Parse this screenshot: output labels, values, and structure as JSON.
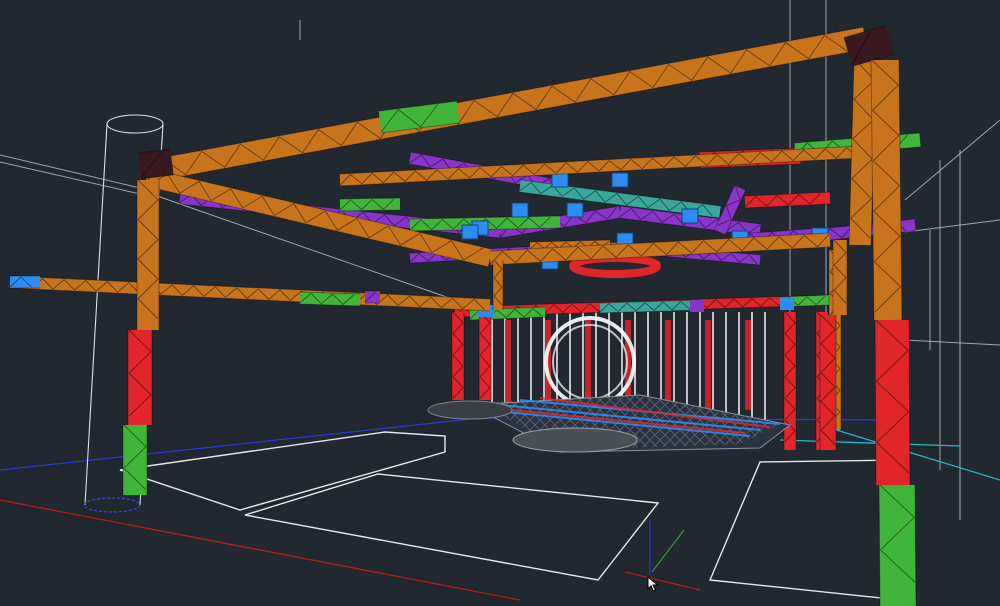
{
  "viewport": {
    "background": "#212830",
    "view_mode": "3D wireframe",
    "icons": [
      "ucs-axis-icon",
      "arrow-pointer-icon"
    ]
  },
  "colors": {
    "truss_orange": "#c8741d",
    "truss_purple": "#8a35c9",
    "truss_red": "#e0262b",
    "truss_green": "#41b53a",
    "truss_blue": "#2c8cf0",
    "truss_teal": "#3aa79c",
    "truss_dark": "#3a1820",
    "wire_white": "#d9dee3",
    "wire_gray": "#8b9096",
    "axis_x_red": "#b42020",
    "axis_y_green": "#2fa12f",
    "axis_z_blue": "#2c3bd6",
    "floor_cyan": "#2ab6c6"
  }
}
